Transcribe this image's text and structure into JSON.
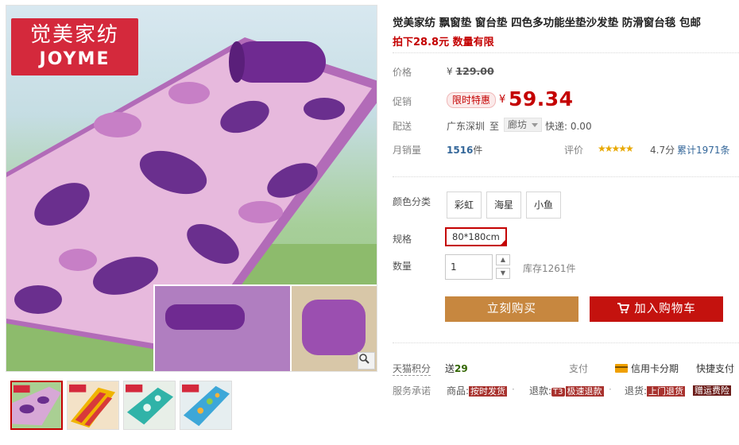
{
  "brand_logo": {
    "cn": "觉美家纺",
    "en": "JOYME"
  },
  "gallery": {
    "thumbnail_count": 4
  },
  "product": {
    "title": "觉美家纺 飘窗垫 窗台垫 四色多功能坐垫沙发垫 防滑窗台毯 包邮",
    "subtitle": "拍下28.8元 数量有限"
  },
  "price": {
    "label": "价格",
    "currency": "¥",
    "original": "129.00"
  },
  "promo": {
    "label": "促销",
    "tag": "限时特惠",
    "currency": "¥",
    "price": "59.34"
  },
  "shipping": {
    "label": "配送",
    "from": "广东深圳",
    "to_word": "至",
    "city": "廊坊",
    "fee": "快递: 0.00"
  },
  "sales": {
    "label": "月销量",
    "count": "1516",
    "unit": "件",
    "rating_label": "评价",
    "stars": "★★★★★",
    "score": "4.7分",
    "reviews": "累计1971条"
  },
  "colors": {
    "label": "颜色分类",
    "options": [
      "彩虹",
      "海星",
      "小鱼"
    ]
  },
  "size": {
    "label": "规格",
    "selected": "80*180cm"
  },
  "quantity": {
    "label": "数量",
    "value": "1",
    "stock": "库存1261件"
  },
  "actions": {
    "buy": "立刻购买",
    "cart": "加入购物车"
  },
  "tmall_points": {
    "label": "天猫积分",
    "prefix": "送",
    "value": "29"
  },
  "payment": {
    "label": "支付",
    "credit": "信用卡分期",
    "quick": "快捷支付"
  },
  "services": {
    "label": "服务承诺",
    "goods_label": "商品:",
    "goods_tag": "按时发货",
    "refund_label": "退款:",
    "refund_t3": "T3",
    "refund_tag": "极速退款",
    "return_label": "退货:",
    "return_tag": "上门退货",
    "gift_tag": "赠运费险"
  },
  "colors_palette": {
    "accent_red": "#c40000",
    "buy_button": "#c7873f",
    "cart_button": "#c4120e",
    "link_blue": "#336699"
  }
}
